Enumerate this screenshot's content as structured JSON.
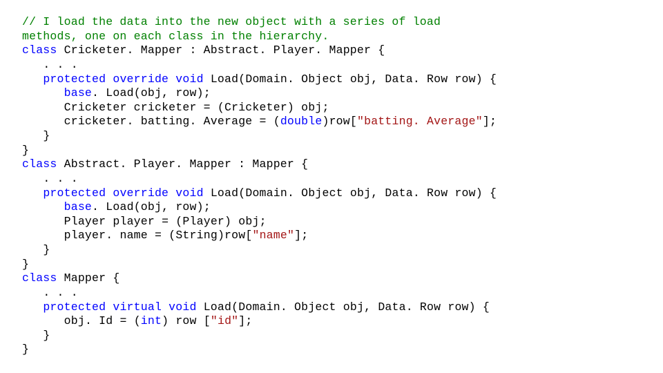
{
  "code": {
    "comment1": "// I load the data into the new object with a series of load",
    "comment2": "methods, one on each class in the hierarchy.",
    "kw_class": "class",
    "kw_protected": "protected",
    "kw_override": "override",
    "kw_virtual": "virtual",
    "kw_void": "void",
    "kw_base": "base",
    "kw_double": "double",
    "kw_int": "int",
    "cls_cricketMapper": "Cricketer. Mapper",
    "cls_abstractPlayerMapper": "Abstract. Player. Mapper",
    "cls_mapper": "Mapper",
    "type_domainObject": "Domain. Object",
    "type_dataRow": "Data. Row",
    "type_cricketer": "Cricketer",
    "type_player": "Player",
    "type_string": "String",
    "method_load": "Load",
    "param_obj": "obj",
    "param_row": "row",
    "var_cricketer": "cricketer",
    "var_player": "player",
    "prop_battingAverage": "batting. Average",
    "prop_name": "name",
    "prop_id": "Id",
    "str_battingAverage": "\"batting. Average\"",
    "str_name": "\"name\"",
    "str_id": "\"id\"",
    "ellipsis": ". . .",
    "colon": " : ",
    "lbrace": " {",
    "rbrace": "}",
    "lparen": "(",
    "rparen": ")",
    "lbracket": "[",
    "rbracket": "]",
    "semi": ";",
    "comma": ", ",
    "dot": ". ",
    "eq": " = ",
    "sp": " "
  }
}
